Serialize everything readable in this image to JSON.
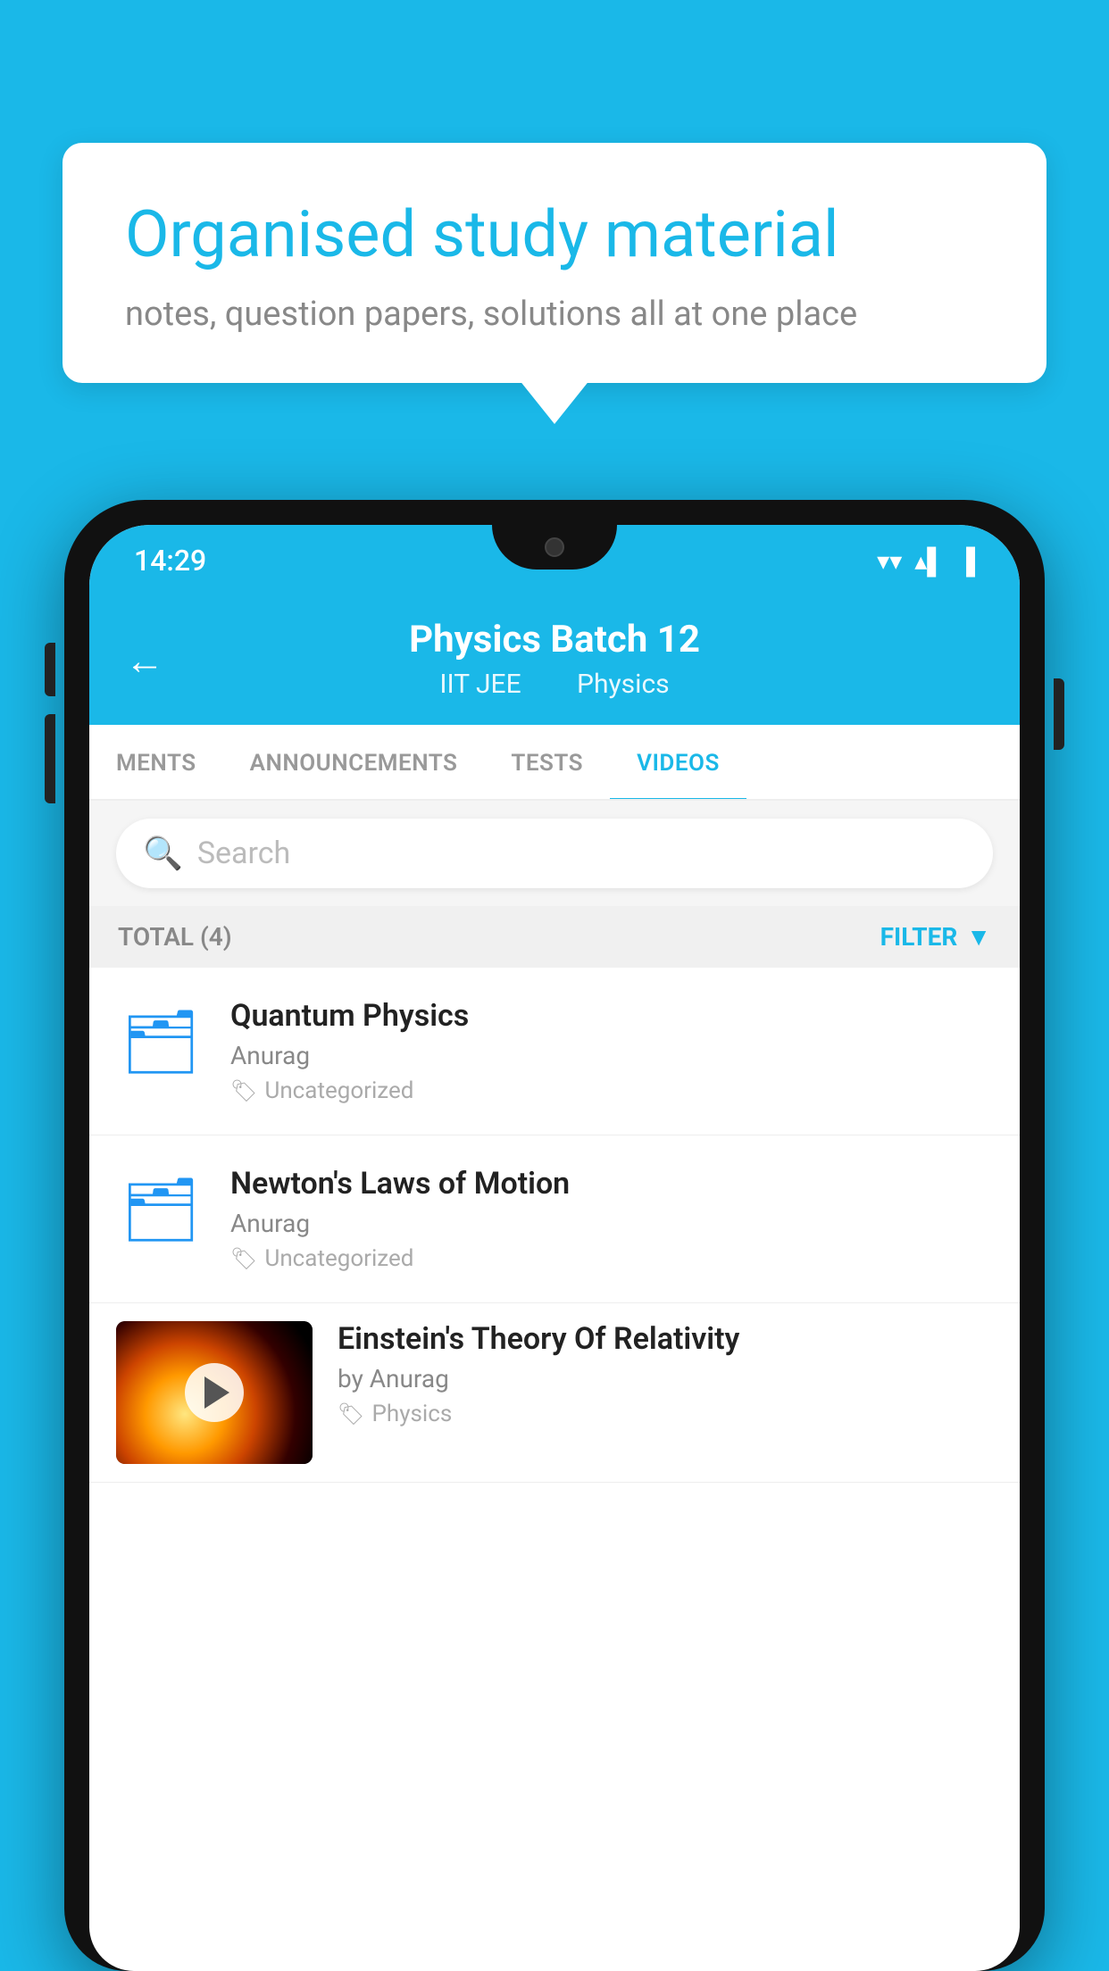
{
  "background": {
    "color": "#1ab8e8"
  },
  "speech_bubble": {
    "title": "Organised study material",
    "subtitle": "notes, question papers, solutions all at one place"
  },
  "phone": {
    "status_bar": {
      "time": "14:29",
      "wifi": "▾",
      "signal": "▴",
      "battery": "▐"
    },
    "header": {
      "back_label": "←",
      "title": "Physics Batch 12",
      "subtitle_left": "IIT JEE",
      "subtitle_right": "Physics"
    },
    "tabs": [
      {
        "label": "MENTS",
        "active": false
      },
      {
        "label": "ANNOUNCEMENTS",
        "active": false
      },
      {
        "label": "TESTS",
        "active": false
      },
      {
        "label": "VIDEOS",
        "active": true
      }
    ],
    "search": {
      "placeholder": "Search"
    },
    "filter": {
      "total_label": "TOTAL (4)",
      "filter_label": "FILTER"
    },
    "videos": [
      {
        "id": 1,
        "title": "Quantum Physics",
        "author": "Anurag",
        "tag": "Uncategorized",
        "has_thumbnail": false
      },
      {
        "id": 2,
        "title": "Newton's Laws of Motion",
        "author": "Anurag",
        "tag": "Uncategorized",
        "has_thumbnail": false
      },
      {
        "id": 3,
        "title": "Einstein's Theory Of Relativity",
        "author": "by Anurag",
        "tag": "Physics",
        "has_thumbnail": true
      }
    ]
  }
}
